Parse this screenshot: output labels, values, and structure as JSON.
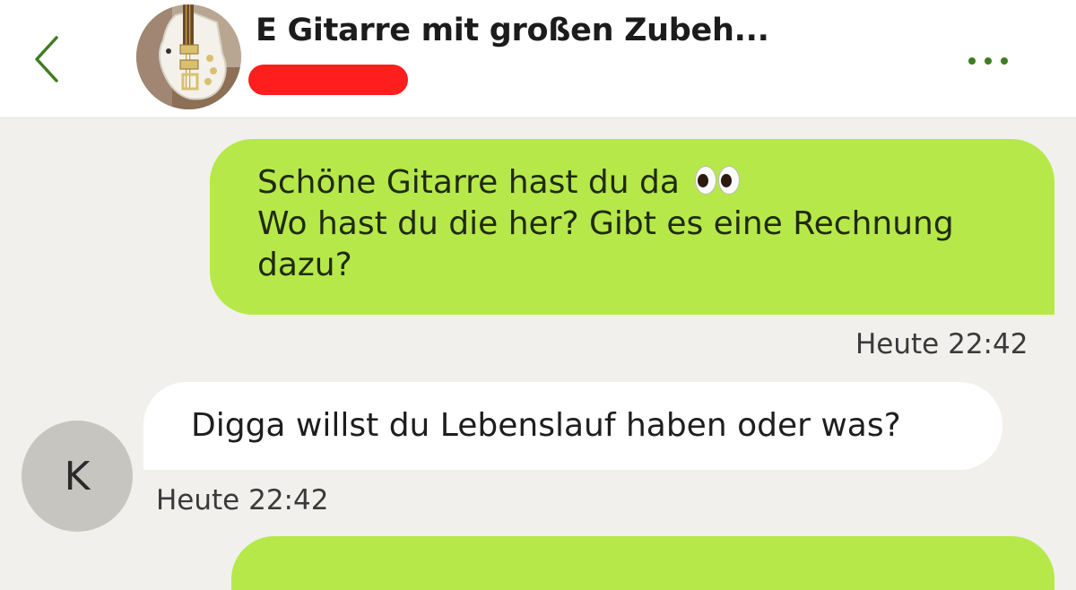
{
  "header": {
    "back_icon": "chevron-left-icon",
    "title": "E Gitarre mit großen Zubeh...",
    "more_icon": "more-horizontal-icon",
    "accent_color": "#3f7d22"
  },
  "messages": [
    {
      "direction": "outgoing",
      "lines": [
        "Schöne Gitarre hast du da",
        "Wo hast du die her? Gibt es eine Rechnung",
        "dazu?"
      ],
      "emoji": "eyes",
      "time": "Heute 22:42"
    },
    {
      "direction": "incoming",
      "text": "Digga willst du Lebenslauf haben oder was?",
      "avatar_letter": "K",
      "time": "Heute 22:42"
    },
    {
      "direction": "outgoing",
      "text": ""
    }
  ],
  "colors": {
    "outgoing_bubble": "#b6e84a",
    "incoming_bubble": "#ffffff",
    "background": "#f1f0ec",
    "redaction": "#ff1e1e"
  }
}
